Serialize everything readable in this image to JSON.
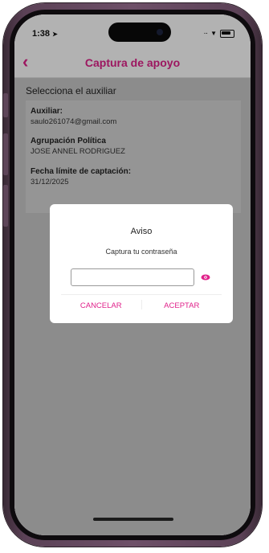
{
  "status_bar": {
    "time": "1:38",
    "location_glyph": "➤",
    "signal_glyph": "··",
    "wifi_glyph": "▼",
    "icons": [
      "location-arrow-icon",
      "signal-icon",
      "wifi-icon",
      "battery-icon"
    ]
  },
  "nav": {
    "back_glyph": "‹",
    "title": "Captura de apoyo"
  },
  "section": {
    "header": "Selecciona el auxiliar"
  },
  "fields": [
    {
      "label": "Auxiliar:",
      "value": "saulo261074@gmail.com"
    },
    {
      "label": "Agrupación Política",
      "value": "JOSE ANNEL RODRIGUEZ"
    },
    {
      "label": "Fecha límite de captación:",
      "value": "31/12/2025"
    }
  ],
  "dialog": {
    "title": "Aviso",
    "message": "Captura tu contraseña",
    "input_value": "",
    "cancel_label": "CANCELAR",
    "accept_label": "ACEPTAR"
  },
  "colors": {
    "accent": "#e0218a",
    "content_bg": "#c9c9c9",
    "frame": "#6e5068"
  }
}
